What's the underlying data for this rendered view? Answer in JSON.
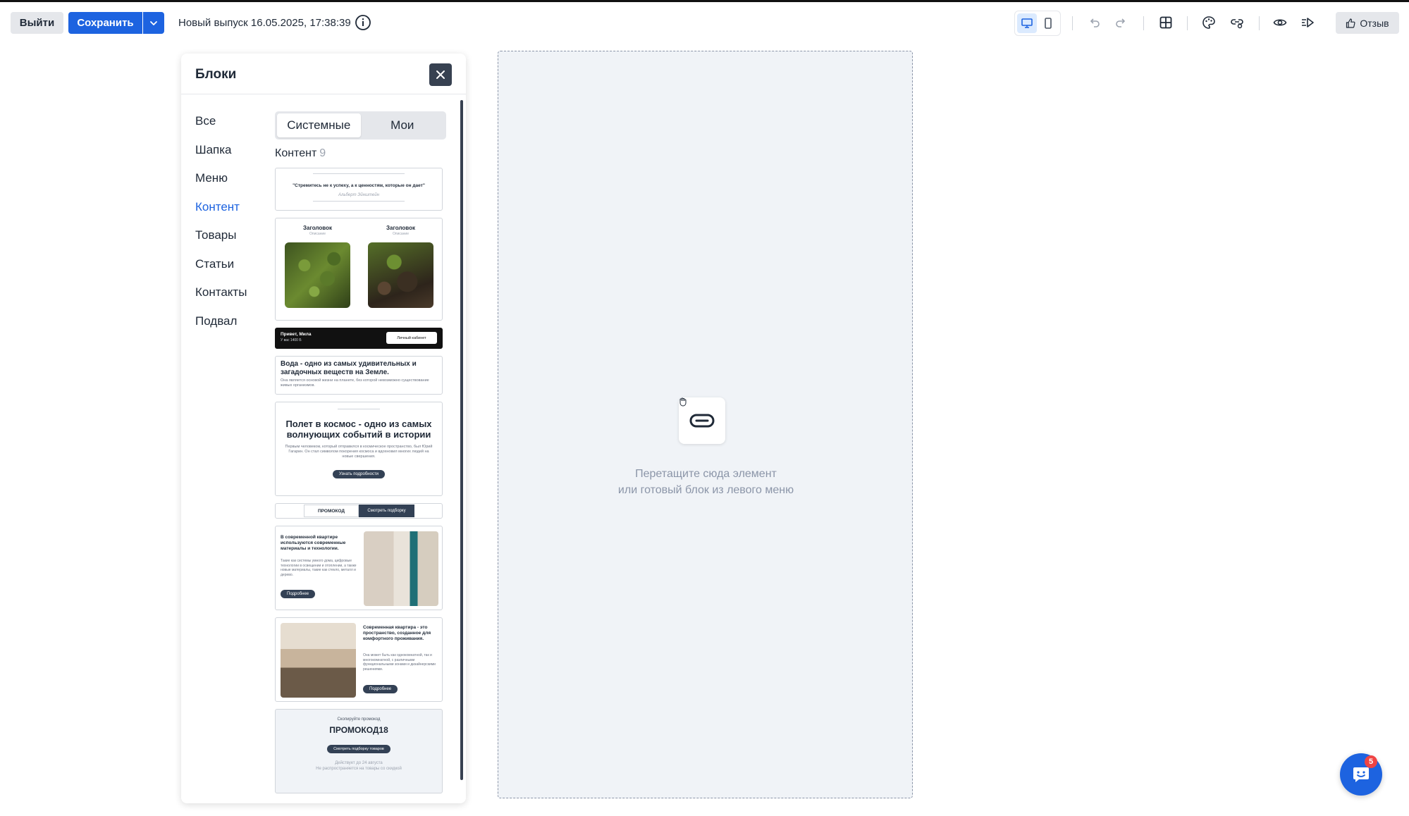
{
  "toolbar": {
    "exit_label": "Выйти",
    "save_label": "Сохранить",
    "release_title": "Новый выпуск 16.05.2025, 17:38:39",
    "feedback_label": "Отзыв",
    "icons": [
      "desktop-icon",
      "mobile-icon",
      "undo-icon",
      "redo-icon",
      "grid-icon",
      "palette-icon",
      "link-settings-icon",
      "preview-eye-icon",
      "send-test-icon",
      "thumbs-up-icon"
    ],
    "accent": "#1d63e0"
  },
  "panel": {
    "title": "Блоки",
    "categories": [
      "Все",
      "Шапка",
      "Меню",
      "Контент",
      "Товары",
      "Статьи",
      "Контакты",
      "Подвал"
    ],
    "active_category": "Контент",
    "tabs": [
      "Системные",
      "Мои"
    ],
    "active_tab": "Системные",
    "section_label": "Контент",
    "section_count": "9",
    "thumbnails": {
      "quote": {
        "text": "\"Стремитесь не к успеху, а к ценностям, которые он дает\"",
        "author": "Альберт Эйнштейн"
      },
      "two_col": {
        "heading_left": "Заголовок",
        "desc_left": "Описание",
        "heading_right": "Заголовок",
        "desc_right": "Описание"
      },
      "greeting": {
        "title": "Привет, Мила",
        "subtitle": "У вас 1400 Б",
        "button": "Личный кабинет"
      },
      "water": {
        "title": "Вода - одно из самых удивительных и загадочных веществ на Земле.",
        "body": "Она является основой жизни на планете, без которой невозможно существование живых организмов."
      },
      "space": {
        "title": "Полет в космос - одно из самых волнующих событий в истории",
        "body": "Первым человеком, который отправился в космическое пространство, был Юрий Гагарин. Он стал символом покорения космоса и вдохновил многих людей на новые свершения.",
        "button": "Узнать подробности"
      },
      "promo_tabs": {
        "left": "ПРОМОКОД",
        "right": "Смотреть подборку"
      },
      "apartment1": {
        "title": "В современной квартире используются современные материалы и технологии.",
        "body": "Такие как системы умного дома, цифровые технологии в освещении и отоплении, а также новые материалы, такие как стекло, металл и дерево.",
        "button": "Подробнее"
      },
      "apartment2": {
        "title": "Современная квартира - это пространство, созданное для комфортного проживания.",
        "body": "Она может быть как однокомнатной, так и многокомнатной, с различными функциональными зонами и дизайнерскими решениями.",
        "button": "Подробнее"
      },
      "promocode": {
        "caption": "Скопируйте промокод",
        "code": "ПРОМОКОД18",
        "button": "Смотреть подборку товаров",
        "note1": "Действует до 24 августа",
        "note2": "Не распространяется на товары со скидкой"
      }
    }
  },
  "canvas": {
    "hint_line1": "Перетащите сюда элемент",
    "hint_line2": "или готовый блок из левого меню"
  },
  "chat": {
    "badge": "5"
  }
}
